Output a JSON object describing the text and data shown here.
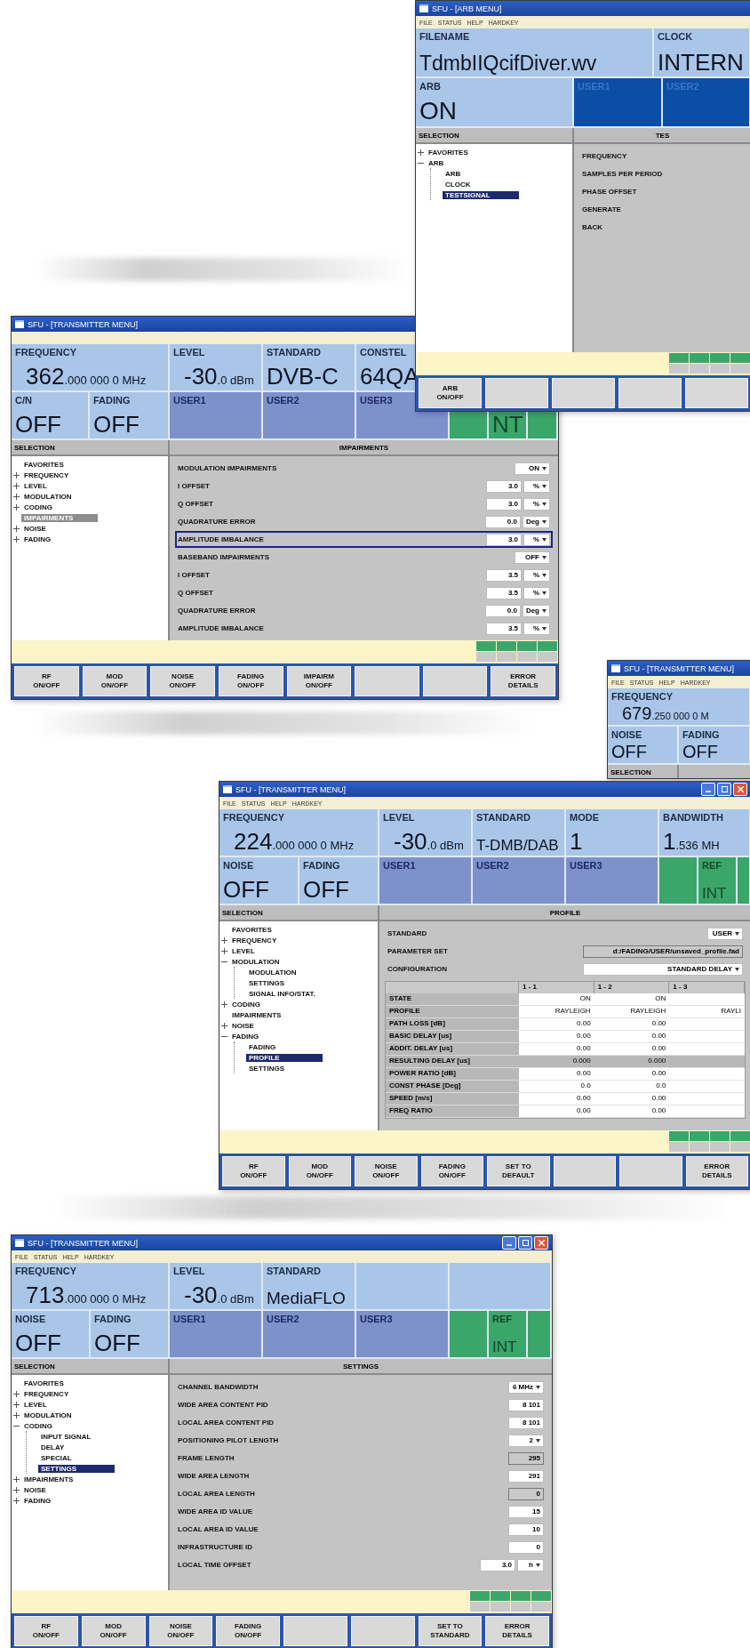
{
  "windows": [
    {
      "title": "SFU - [ARB MENU]",
      "menu": [
        "FILE",
        "STATUS",
        "HELP",
        "HARDKEY"
      ],
      "row1": [
        {
          "label": "FILENAME",
          "value": "TdmbIIQcifDiver.wv",
          "kind": "light"
        },
        {
          "label": "CLOCK",
          "value": "INTERN",
          "kind": "light"
        }
      ],
      "row2": [
        {
          "label": "ARB",
          "value": "ON",
          "kind": "light"
        },
        {
          "label": "USER1",
          "kind": "dark"
        },
        {
          "label": "USER2",
          "kind": "dark"
        }
      ],
      "selection_label": "SELECTION",
      "panel_title": "TES",
      "tree_active": true,
      "tree": [
        {
          "label": "FAVORITES",
          "selected": false,
          "expanded": false
        },
        {
          "label": "ARB",
          "selected": false,
          "expanded": true,
          "children": [
            {
              "label": "ARB",
              "selected": false
            },
            {
              "label": "CLOCK",
              "selected": false
            },
            {
              "label": "TESTSIGNAL",
              "selected": true
            }
          ]
        }
      ],
      "params": [
        {
          "label": "FREQUENCY"
        },
        {
          "label": "SAMPLES PER PERIOD"
        },
        {
          "label": "PHASE OFFSET"
        },
        {
          "label": "GENERATE"
        },
        {
          "label": "BACK"
        }
      ],
      "softkeys": [
        {
          "kind": "key",
          "label": "ARB\nON/OFF"
        },
        {
          "kind": "blank"
        },
        {
          "kind": "blank"
        },
        {
          "kind": "blank"
        },
        {
          "kind": "blank"
        }
      ]
    },
    {
      "title": "SFU - [TRANSMITTER MENU]",
      "row1": [
        {
          "label": "FREQUENCY",
          "value": "362",
          "fraction": ".000 000 0 MHz",
          "kind": "light"
        },
        {
          "label": "LEVEL",
          "value": "-30",
          "fraction": ".0 dBm",
          "kind": "light"
        },
        {
          "label": "STANDARD",
          "value": "DVB-C",
          "kind": "light"
        },
        {
          "label": "CONSTEL",
          "value": "64QA",
          "kind": "light"
        }
      ],
      "row2": [
        {
          "label": "C/N",
          "value": "OFF",
          "kind": "light"
        },
        {
          "label": "FADING",
          "value": "OFF",
          "kind": "light"
        },
        {
          "label": "USER1",
          "kind": "user"
        },
        {
          "label": "USER2",
          "kind": "user"
        },
        {
          "label": "USER3",
          "kind": "user"
        },
        {
          "kind": "green"
        },
        {
          "value": "NT",
          "kind": "green"
        },
        {
          "kind": "green"
        }
      ],
      "selection_label": "SELECTION",
      "panel_title": "IMPAIRMENTS",
      "tree_active": false,
      "tree": [
        {
          "label": "FAVORITES",
          "selected": false
        },
        {
          "label": "FREQUENCY",
          "selected": false,
          "expanded": false
        },
        {
          "label": "LEVEL",
          "selected": false,
          "expanded": false
        },
        {
          "label": "MODULATION",
          "selected": false,
          "expanded": false
        },
        {
          "label": "CODING",
          "selected": false,
          "expanded": false
        },
        {
          "label": "IMPAIRMENTS",
          "selected": true
        },
        {
          "label": "NOISE",
          "selected": false,
          "expanded": false
        },
        {
          "label": "FADING",
          "selected": false,
          "expanded": false
        }
      ],
      "params": [
        {
          "label": "MODULATION IMPAIRMENTS",
          "kind": "select",
          "value": "ON",
          "focused": false
        },
        {
          "label": "I OFFSET",
          "kind": "input",
          "value": "3.0",
          "unit": "%",
          "focused": false
        },
        {
          "label": "Q OFFSET",
          "kind": "input",
          "value": "3.0",
          "unit": "%",
          "focused": false
        },
        {
          "label": "QUADRATURE ERROR",
          "kind": "input",
          "value": "0.0",
          "unit": "Deg",
          "focused": false
        },
        {
          "label": "AMPLITUDE IMBALANCE",
          "kind": "input",
          "value": "3.0",
          "unit": "%",
          "focused": true
        },
        {
          "label": "BASEBAND IMPAIRMENTS",
          "kind": "select",
          "value": "OFF",
          "focused": false
        },
        {
          "label": "I OFFSET",
          "kind": "input",
          "value": "3.5",
          "unit": "%",
          "focused": false
        },
        {
          "label": "Q OFFSET",
          "kind": "input",
          "value": "3.5",
          "unit": "%",
          "focused": false
        },
        {
          "label": "QUADRATURE ERROR",
          "kind": "input",
          "value": "0.0",
          "unit": "Deg",
          "focused": false
        },
        {
          "label": "AMPLITUDE IMBALANCE",
          "kind": "input",
          "value": "3.5",
          "unit": "%",
          "focused": false
        }
      ],
      "softkeys": [
        {
          "kind": "key",
          "label": "RF\nON/OFF"
        },
        {
          "kind": "key",
          "label": "MOD\nON/OFF"
        },
        {
          "kind": "key",
          "label": "NOISE\nON/OFF"
        },
        {
          "kind": "key",
          "label": "FADING\nON/OFF"
        },
        {
          "kind": "key",
          "label": "IMPAIRM\nON/OFF"
        },
        {
          "kind": "blank"
        },
        {
          "kind": "blank"
        },
        {
          "kind": "key",
          "label": "ERROR\nDETAILS"
        }
      ]
    },
    {
      "title": "SFU - [TRANSMITTER MENU]",
      "menu": [
        "FILE",
        "STATUS",
        "HELP",
        "HARDKEY"
      ],
      "row1": [
        {
          "label": "FREQUENCY",
          "value": "679",
          "fraction": ".250 000 0 M",
          "kind": "light"
        }
      ],
      "row2": [
        {
          "label": "NOISE",
          "value": "OFF",
          "kind": "light"
        },
        {
          "label": "FADING",
          "value": "OFF",
          "kind": "light"
        }
      ],
      "selection_label": "SELECTION"
    },
    {
      "title": "SFU - [TRANSMITTER MENU]",
      "title_buttons": true,
      "menu": [
        "FILE",
        "STATUS",
        "HELP",
        "HARDKEY"
      ],
      "row1": [
        {
          "label": "FREQUENCY",
          "value": "224",
          "fraction": ".000 000 0 MHz",
          "kind": "light"
        },
        {
          "label": "LEVEL",
          "value": "-30",
          "fraction": ".0 dBm",
          "kind": "light"
        },
        {
          "label": "STANDARD",
          "value": "T-DMB/DAB",
          "kind": "light"
        },
        {
          "label": "MODE",
          "value": "1",
          "kind": "light"
        },
        {
          "label": "BANDWIDTH",
          "value": "1",
          "fraction": ".536 MH",
          "kind": "light"
        }
      ],
      "row2": [
        {
          "label": "NOISE",
          "value": "OFF",
          "kind": "light"
        },
        {
          "label": "FADING",
          "value": "OFF",
          "kind": "light"
        },
        {
          "label": "USER1",
          "kind": "user"
        },
        {
          "label": "USER2",
          "kind": "user"
        },
        {
          "label": "USER3",
          "kind": "user"
        },
        {
          "kind": "green"
        },
        {
          "label": "REF",
          "value": "INT",
          "kind": "green"
        },
        {
          "kind": "green"
        }
      ],
      "selection_label": "SELECTION",
      "panel_title": "PROFILE",
      "tree_active": true,
      "tree": [
        {
          "label": "FAVORITES",
          "selected": false
        },
        {
          "label": "FREQUENCY",
          "selected": false,
          "expanded": false
        },
        {
          "label": "LEVEL",
          "selected": false,
          "expanded": false
        },
        {
          "label": "MODULATION",
          "selected": false,
          "expanded": true,
          "children": [
            {
              "label": "MODULATION",
              "selected": false
            },
            {
              "label": "SETTINGS",
              "selected": false
            },
            {
              "label": "SIGNAL INFO/STAT.",
              "selected": false
            }
          ]
        },
        {
          "label": "CODING",
          "selected": false,
          "expanded": false
        },
        {
          "label": "IMPAIRMENTS",
          "selected": false
        },
        {
          "label": "NOISE",
          "selected": false,
          "expanded": false
        },
        {
          "label": "FADING",
          "selected": false,
          "expanded": true,
          "children": [
            {
              "label": "FADING",
              "selected": false
            },
            {
              "label": "PROFILE",
              "selected": true
            },
            {
              "label": "SETTINGS",
              "selected": false
            }
          ]
        }
      ],
      "params": [
        {
          "label": "STANDARD",
          "kind": "select",
          "value": "USER"
        },
        {
          "label": "PARAMETER SET",
          "kind": "readonly",
          "value": "d:/FADING/USER/unsaved_profile.fad"
        },
        {
          "label": "CONFIGURATION",
          "kind": "select",
          "value": "STANDARD DELAY"
        }
      ],
      "table": {
        "columns": [
          "1 - 1",
          "1 - 2",
          "1 - 3"
        ],
        "rows": [
          {
            "label": "STATE",
            "cells": [
              "ON",
              "ON"
            ],
            "highlighted": false
          },
          {
            "label": "PROFILE",
            "cells": [
              "RAYLEIGH",
              "RAYLEIGH",
              "RAYLI"
            ],
            "highlighted": false
          },
          {
            "label": "PATH LOSS [dB]",
            "cells": [
              "0.00",
              "0.00"
            ],
            "highlighted": false
          },
          {
            "label": "BASIC DELAY [us]",
            "cells": [
              "0.00",
              "0.00"
            ],
            "highlighted": false
          },
          {
            "label": "ADDIT. DELAY [us]",
            "cells": [
              "0.00",
              "0.00"
            ],
            "highlighted": false
          },
          {
            "label": "RESULTING DELAY [us]",
            "cells": [
              "0.000",
              "0.000"
            ],
            "highlighted": true
          },
          {
            "label": "POWER RATIO [dB]",
            "cells": [
              "0.00",
              "0.00"
            ],
            "highlighted": false
          },
          {
            "label": "CONST PHASE [Deg]",
            "cells": [
              "0.0",
              "0.0"
            ],
            "highlighted": false
          },
          {
            "label": "SPEED [m/s]",
            "cells": [
              "0.00",
              "0.00"
            ],
            "highlighted": false
          },
          {
            "label": "FREQ RATIO",
            "cells": [
              "0.00",
              "0.00"
            ],
            "highlighted": false
          }
        ]
      },
      "softkeys": [
        {
          "kind": "key",
          "label": "RF\nON/OFF"
        },
        {
          "kind": "key",
          "label": "MOD\nON/OFF"
        },
        {
          "kind": "key",
          "label": "NOISE\nON/OFF"
        },
        {
          "kind": "key",
          "label": "FADING\nON/OFF"
        },
        {
          "kind": "key",
          "label": "SET TO\nDEFAULT"
        },
        {
          "kind": "blank"
        },
        {
          "kind": "blank"
        },
        {
          "kind": "key",
          "label": "ERROR\nDETAILS"
        }
      ]
    },
    {
      "title": "SFU - [TRANSMITTER MENU]",
      "title_buttons": true,
      "menu": [
        "FILE",
        "STATUS",
        "HELP",
        "HARDKEY"
      ],
      "row1": [
        {
          "label": "FREQUENCY",
          "value": "713",
          "fraction": ".000 000 0 MHz",
          "kind": "light"
        },
        {
          "label": "LEVEL",
          "value": "-30",
          "fraction": ".0 dBm",
          "kind": "light"
        },
        {
          "label": "STANDARD",
          "value": "MediaFLO",
          "kind": "light"
        },
        {
          "kind": "light"
        },
        {
          "kind": "light"
        }
      ],
      "row2": [
        {
          "label": "NOISE",
          "value": "OFF",
          "kind": "light"
        },
        {
          "label": "FADING",
          "value": "OFF",
          "kind": "light"
        },
        {
          "label": "USER1",
          "kind": "user"
        },
        {
          "label": "USER2",
          "kind": "user"
        },
        {
          "label": "USER3",
          "kind": "user"
        },
        {
          "kind": "green"
        },
        {
          "label": "REF",
          "value": "INT",
          "kind": "green"
        },
        {
          "kind": "green"
        }
      ],
      "selection_label": "SELECTION",
      "panel_title": "SETTINGS",
      "tree_active": true,
      "tree": [
        {
          "label": "FAVORITES",
          "selected": false
        },
        {
          "label": "FREQUENCY",
          "selected": false,
          "expanded": false
        },
        {
          "label": "LEVEL",
          "selected": false,
          "expanded": false
        },
        {
          "label": "MODULATION",
          "selected": false,
          "expanded": false
        },
        {
          "label": "CODING",
          "selected": false,
          "expanded": true,
          "children": [
            {
              "label": "INPUT SIGNAL",
              "selected": false
            },
            {
              "label": "DELAY",
              "selected": false
            },
            {
              "label": "SPECIAL",
              "selected": false
            },
            {
              "label": "SETTINGS",
              "selected": true
            }
          ]
        },
        {
          "label": "IMPAIRMENTS",
          "selected": false,
          "expanded": false
        },
        {
          "label": "NOISE",
          "selected": false,
          "expanded": false
        },
        {
          "label": "FADING",
          "selected": false,
          "expanded": false
        }
      ],
      "params": [
        {
          "label": "CHANNEL BANDWIDTH",
          "kind": "select",
          "value": "6 MHz"
        },
        {
          "label": "WIDE AREA CONTENT PID",
          "kind": "input",
          "value": "8 101"
        },
        {
          "label": "LOCAL AREA CONTENT PID",
          "kind": "input",
          "value": "8 101"
        },
        {
          "label": "POSITIONING PILOT LENGTH",
          "kind": "select",
          "value": "2"
        },
        {
          "label": "FRAME LENGTH",
          "kind": "readonly",
          "value": "295"
        },
        {
          "label": "WIDE AREA LENGTH",
          "kind": "input",
          "value": "291"
        },
        {
          "label": "LOCAL AREA LENGTH",
          "kind": "readonly",
          "value": "0"
        },
        {
          "label": "WIDE AREA ID VALUE",
          "kind": "input",
          "value": "15"
        },
        {
          "label": "LOCAL AREA ID VALUE",
          "kind": "input",
          "value": "10"
        },
        {
          "label": "INFRASTRUCTURE ID",
          "kind": "input",
          "value": "0"
        },
        {
          "label": "LOCAL TIME OFFSET",
          "kind": "input",
          "value": "3.0",
          "unit": "h"
        }
      ],
      "softkeys": [
        {
          "kind": "key",
          "label": "RF\nON/OFF"
        },
        {
          "kind": "key",
          "label": "MOD\nON/OFF"
        },
        {
          "kind": "key",
          "label": "NOISE\nON/OFF"
        },
        {
          "kind": "key",
          "label": "FADING\nON/OFF"
        },
        {
          "kind": "blank"
        },
        {
          "kind": "blank"
        },
        {
          "kind": "key",
          "label": "SET TO\nSTANDARD"
        },
        {
          "kind": "key",
          "label": "ERROR\nDETAILS"
        }
      ]
    }
  ]
}
